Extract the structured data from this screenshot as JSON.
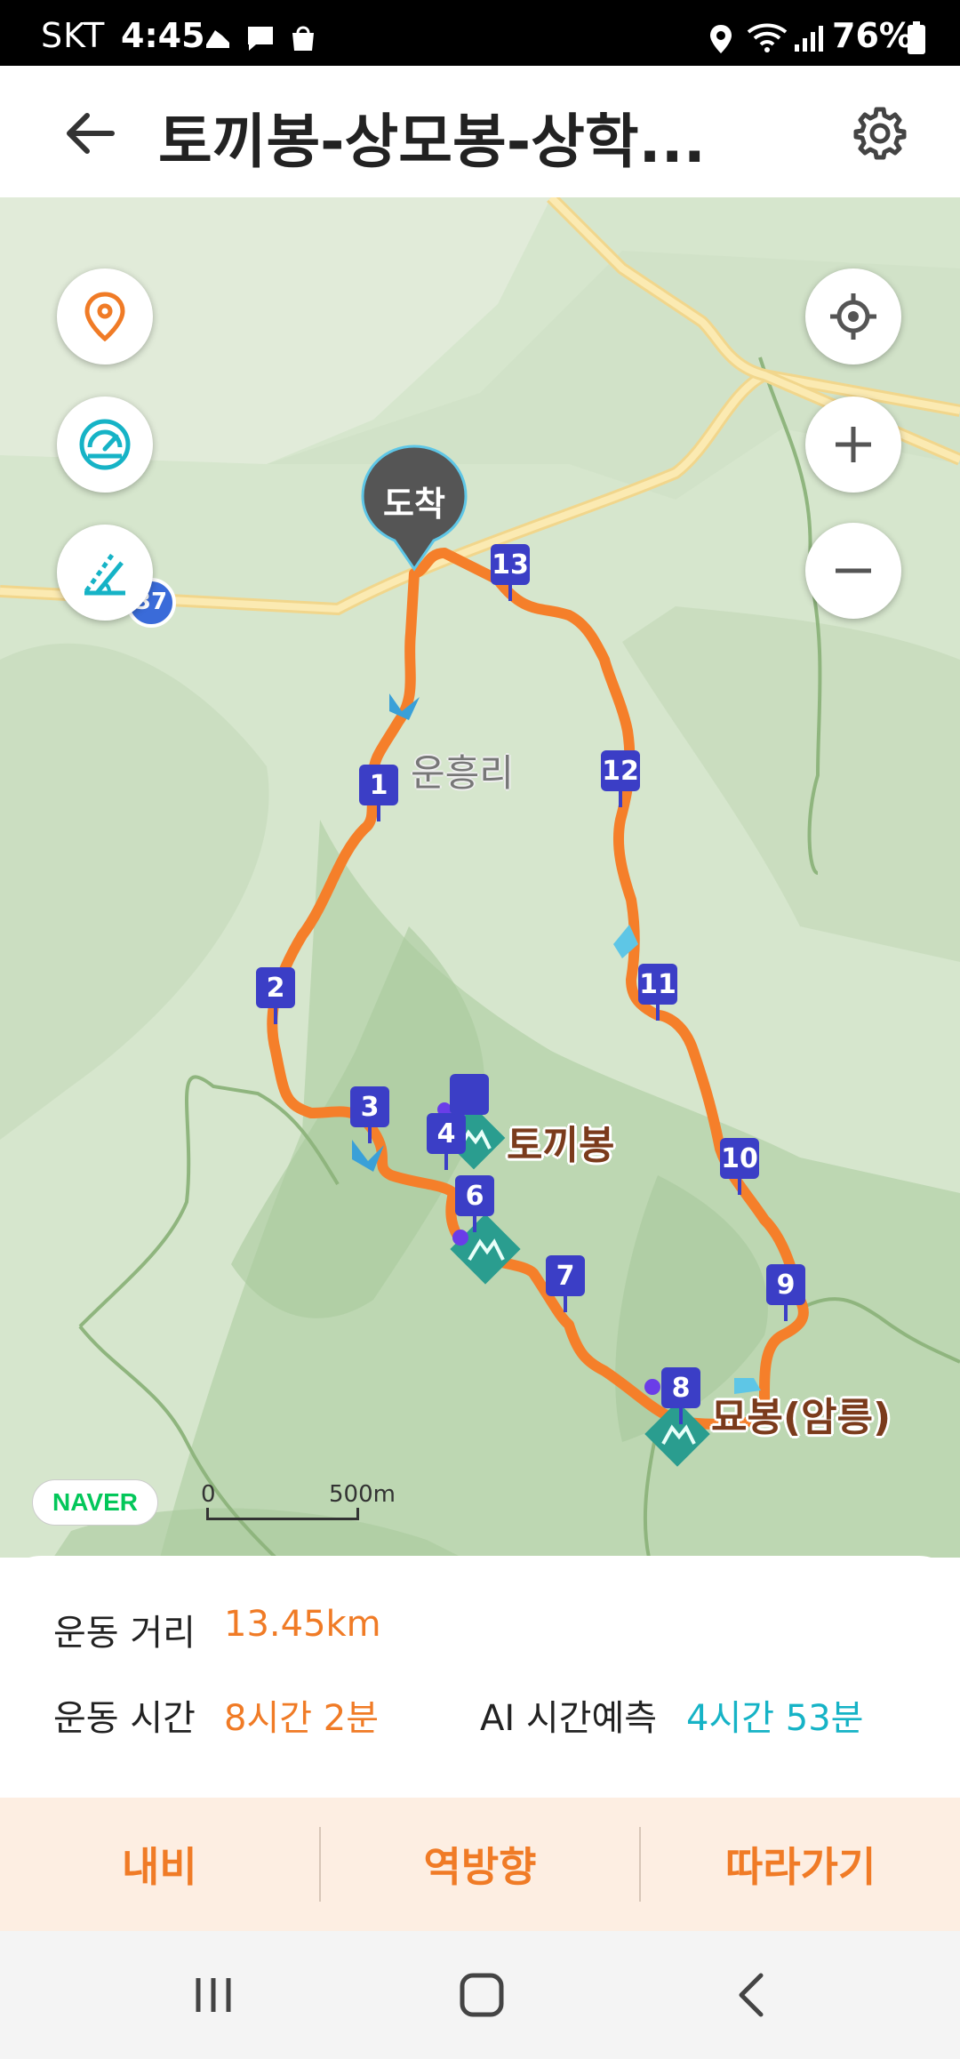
{
  "status_bar": {
    "carrier": "SKT",
    "time": "4:45",
    "battery": "76%"
  },
  "header": {
    "title": "토끼봉-상모봉-상학...",
    "back_icon": "arrow-left-icon",
    "settings_icon": "gear-icon"
  },
  "map": {
    "arrival_pin": "도착",
    "place_name": "운흥리",
    "road_number": "37",
    "pois": [
      {
        "name": "토끼봉"
      },
      {
        "name": "묘봉(암릉)"
      }
    ],
    "waypoints": [
      "1",
      "2",
      "3",
      "4",
      "6",
      "7",
      "8",
      "9",
      "10",
      "11",
      "12",
      "13"
    ],
    "brand": "NAVER",
    "scale": {
      "start": "0",
      "end": "500m"
    },
    "route_color": "#f57f2a",
    "left_buttons": [
      "location-pin-icon",
      "speedometer-icon",
      "elevation-ruler-icon"
    ],
    "right_buttons": [
      "crosshair-icon",
      "zoom-in-icon",
      "zoom-out-icon"
    ]
  },
  "stats": {
    "distance_label": "운동 거리",
    "distance_value": "13.45km",
    "time_label": "운동 시간",
    "time_value": "8시간 2분",
    "ai_label": "AI 시간예측",
    "ai_value": "4시간 53분"
  },
  "actions": {
    "navi": "내비",
    "reverse": "역방향",
    "follow": "따라가기"
  },
  "colors": {
    "accent": "#f07b26",
    "teal": "#16b3c6",
    "marker": "#3b3ec6",
    "action_bg": "#fdeee2"
  }
}
